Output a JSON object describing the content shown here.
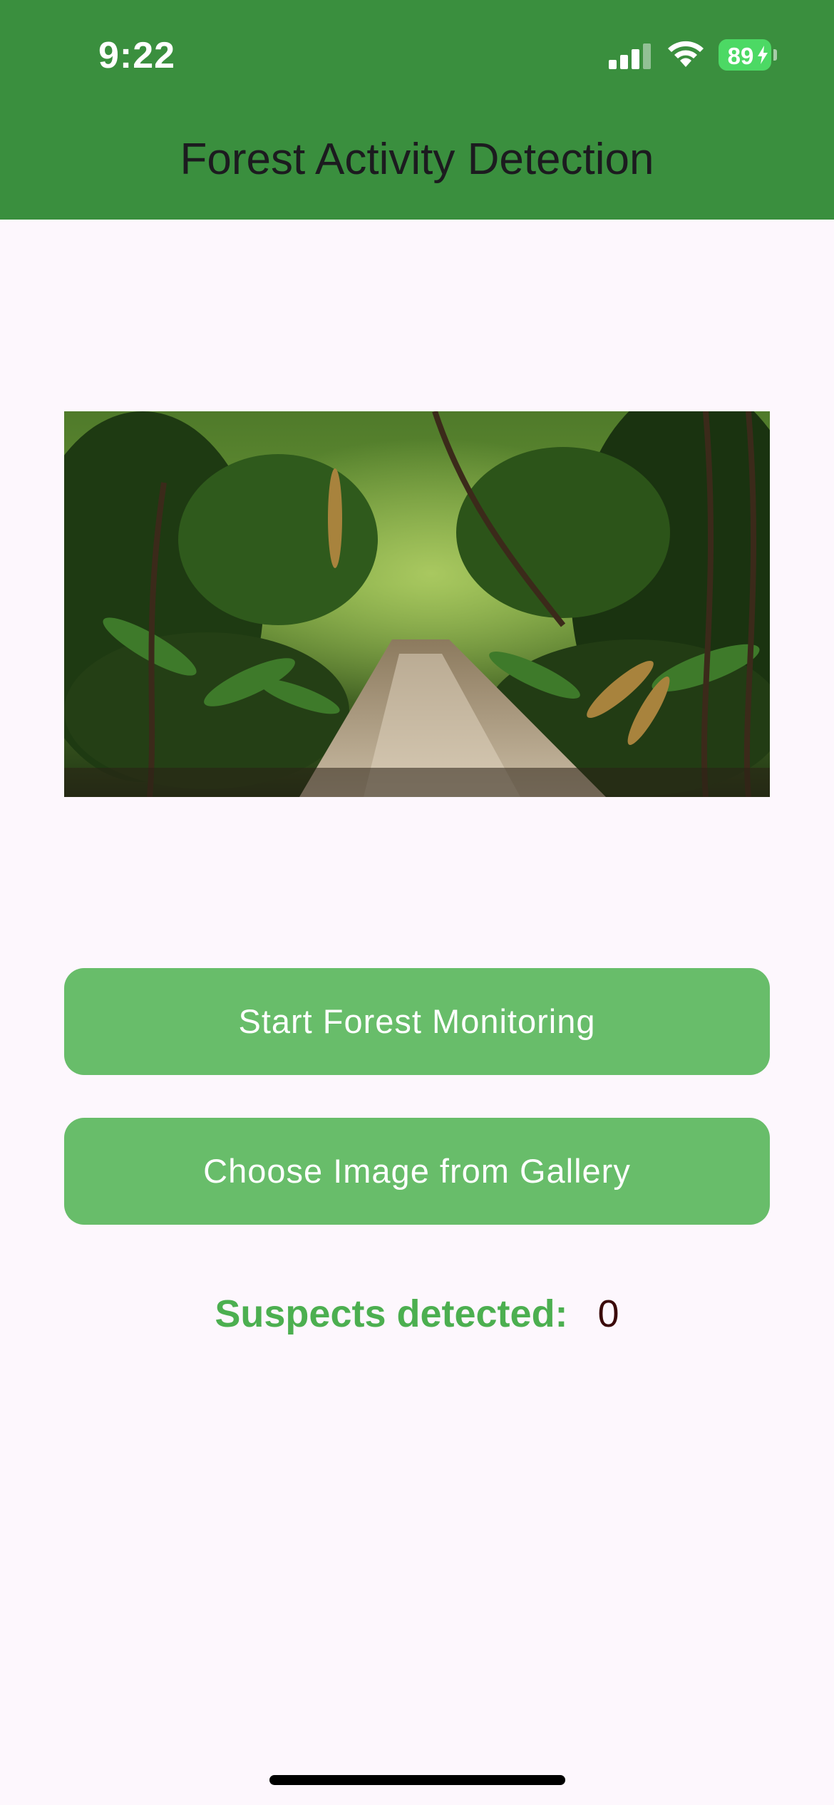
{
  "status_bar": {
    "time": "9:22",
    "battery_level": "89",
    "signal_icon": "cellular-signal-icon",
    "wifi_icon": "wifi-icon",
    "battery_icon": "battery-charging-icon"
  },
  "app_bar": {
    "title": "Forest Activity Detection",
    "color": "#3A8F3E"
  },
  "main": {
    "image_description": "forest-path-photo",
    "start_button_label": "Start Forest Monitoring",
    "gallery_button_label": "Choose Image from Gallery",
    "button_color": "#68BD6A",
    "suspects_label": "Suspects detected:",
    "suspects_count": "0"
  }
}
